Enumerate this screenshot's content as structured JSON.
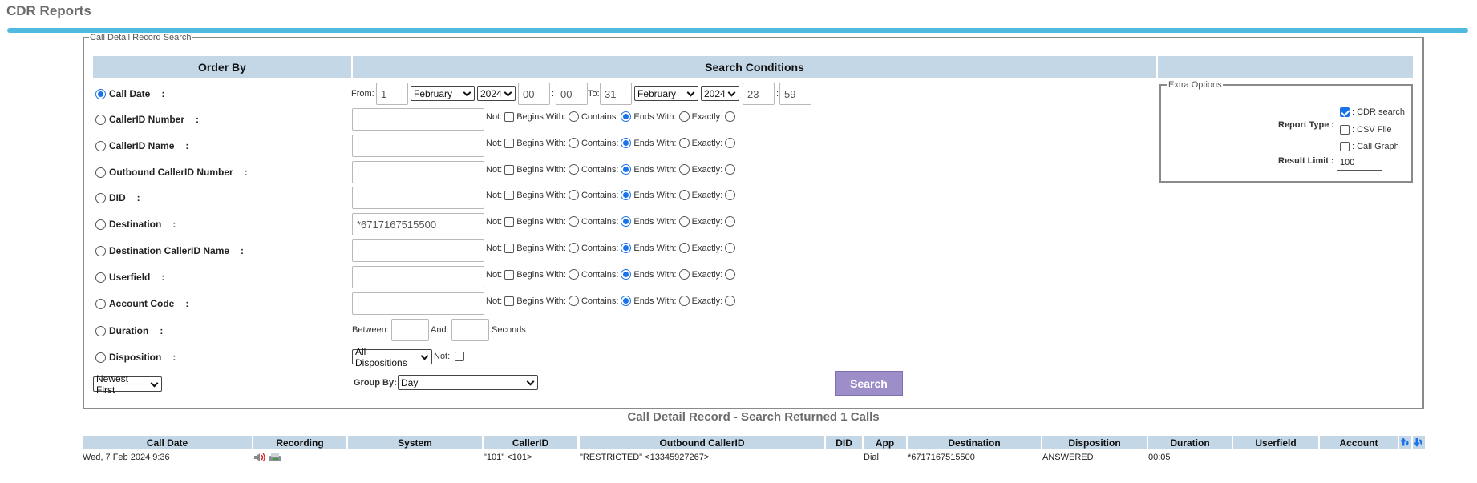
{
  "page": {
    "title": "CDR Reports"
  },
  "form": {
    "legend": "Call Detail Record Search",
    "order_by_header": "Order By",
    "search_conditions_header": "Search Conditions",
    "call_date": {
      "label": "Call Date",
      "colon": ":",
      "from_label": "From:",
      "from_day": "1",
      "from_month": "February",
      "from_year": "2024",
      "from_hour": "00",
      "from_minute": "00",
      "to_label": "To:",
      "to_day": "31",
      "to_month": "February",
      "to_year": "2024",
      "to_hour": "23",
      "to_minute": "59"
    },
    "filter_rows": [
      {
        "label": "CallerID Number",
        "colon": ":",
        "value": ""
      },
      {
        "label": "CallerID Name",
        "colon": ":",
        "value": ""
      },
      {
        "label": "Outbound CallerID Number",
        "colon": ":",
        "value": ""
      },
      {
        "label": "DID",
        "colon": ":",
        "value": ""
      },
      {
        "label": "Destination",
        "colon": ":",
        "value": "*6717167515500"
      },
      {
        "label": "Destination CallerID Name",
        "colon": ":",
        "value": ""
      },
      {
        "label": "Userfield",
        "colon": ":",
        "value": ""
      },
      {
        "label": "Account Code",
        "colon": ":",
        "value": ""
      }
    ],
    "match_options": {
      "not": "Not:",
      "begins": "Begins With:",
      "contains": "Contains:",
      "ends": "Ends With:",
      "exactly": "Exactly:"
    },
    "duration": {
      "label": "Duration",
      "colon": ":",
      "between": "Between:",
      "and": "And:",
      "seconds": "Seconds"
    },
    "disposition": {
      "label": "Disposition",
      "colon": ":",
      "selected": "All Dispositions",
      "not": "Not:"
    },
    "sort_selected": "Newest First",
    "group_by_label": "Group By:",
    "group_by_selected": "Day",
    "search_button": "Search"
  },
  "extra_options": {
    "legend": "Extra Options",
    "report_type_label": "Report Type :",
    "cdr_search": ": CDR search",
    "cdr_search_checked": true,
    "csv_file": ": CSV File",
    "csv_file_checked": false,
    "call_graph": ": Call Graph",
    "call_graph_checked": false,
    "result_limit_label": "Result Limit :",
    "result_limit_value": "100"
  },
  "results": {
    "title": "Call Detail Record - Search Returned 1 Calls",
    "columns": [
      "Call Date",
      "Recording",
      "System",
      "CallerID",
      "Outbound CallerID",
      "DID",
      "App",
      "Destination",
      "Disposition",
      "Duration",
      "Userfield",
      "Account"
    ],
    "rows": [
      {
        "call_date": "Wed, 7 Feb 2024 9:36",
        "system": "",
        "callerid": "\"101\" <101>",
        "outbound_callerid": "\"RESTRICTED\" <13345927267>",
        "did": "",
        "app": "Dial",
        "destination": "*6717167515500",
        "disposition": "ANSWERED",
        "duration": "00:05",
        "userfield": "",
        "account": ""
      }
    ]
  },
  "colors": {
    "accent_bar": "#4fb9e0",
    "header_bg": "#c3d7e6",
    "search_button_bg": "#9d8ec9"
  }
}
